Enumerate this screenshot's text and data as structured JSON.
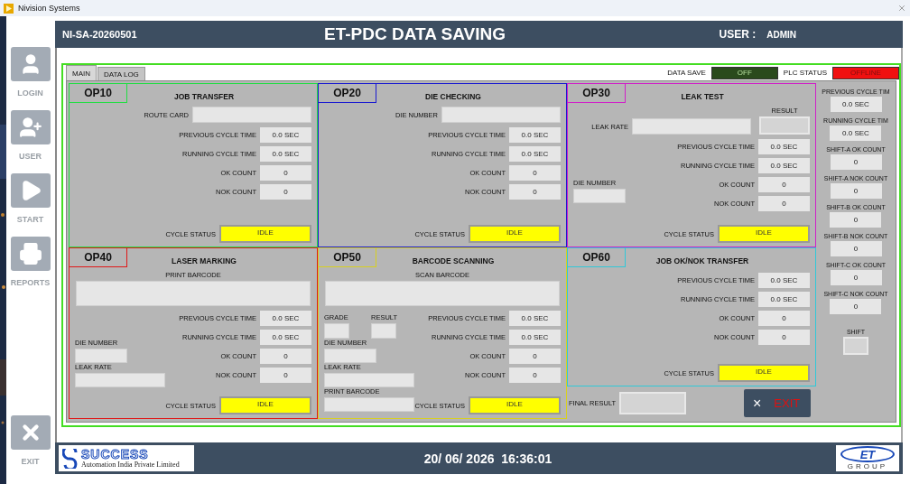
{
  "window": {
    "title": "Nivision Systems"
  },
  "sidebar": {
    "items": [
      {
        "kind": "login",
        "label": "LOGIN"
      },
      {
        "kind": "user",
        "label": "USER"
      },
      {
        "kind": "start",
        "label": "START"
      },
      {
        "kind": "reports",
        "label": "REPORTS"
      },
      {
        "kind": "exit",
        "label": "EXIT"
      }
    ]
  },
  "header": {
    "machine_id": "NI-SA-20260501",
    "title": "ET-PDC DATA SAVING",
    "user_label": "USER :",
    "user": "ADMIN"
  },
  "tabs": [
    {
      "label": "MAIN",
      "selected": true
    },
    {
      "label": "DATA LOG",
      "selected": false
    }
  ],
  "indicators": [
    {
      "kind": "switch",
      "label": "DATA SAVE",
      "value": "OFF",
      "on": false
    },
    {
      "kind": "status",
      "label": "PLC STATUS",
      "value": "OFFLINE",
      "on": false
    }
  ],
  "stations": [
    {
      "tag": "OP10",
      "title": "JOB TRANSFER",
      "color": "#22dd44",
      "top": [
        {
          "kind": "inline",
          "label": "ROUTE CARD"
        }
      ],
      "metrics": [
        {
          "label": "PREVIOUS CYCLE TIME",
          "value": "0.0 SEC"
        },
        {
          "label": "RUNNING CYCLE TIME",
          "value": "0.0 SEC"
        },
        {
          "label": "OK COUNT",
          "value": "0"
        },
        {
          "label": "NOK COUNT",
          "value": "0"
        }
      ],
      "status": {
        "label": "CYCLE STATUS",
        "value": "IDLE"
      }
    },
    {
      "tag": "OP20",
      "title": "DIE CHECKING",
      "color": "#1a1ad0",
      "top": [
        {
          "kind": "inline",
          "label": "DIE NUMBER"
        }
      ],
      "metrics": [
        {
          "label": "PREVIOUS CYCLE TIME",
          "value": "0.0 SEC"
        },
        {
          "label": "RUNNING CYCLE TIME",
          "value": "0.0 SEC"
        },
        {
          "label": "OK COUNT",
          "value": "0"
        },
        {
          "label": "NOK COUNT",
          "value": "0"
        }
      ],
      "status": {
        "label": "CYCLE STATUS",
        "value": "IDLE"
      }
    },
    {
      "tag": "OP30",
      "title": "LEAK TEST",
      "color": "#d020c8",
      "top": [
        {
          "kind": "inline",
          "label": "LEAK RATE"
        },
        {
          "kind": "result",
          "label": "RESULT"
        }
      ],
      "side": [
        {
          "kind": "stacked",
          "label": "DIE NUMBER"
        }
      ],
      "metrics": [
        {
          "label": "PREVIOUS CYCLE TIME",
          "value": "0.0 SEC"
        },
        {
          "label": "RUNNING CYCLE TIME",
          "value": "0.0 SEC"
        },
        {
          "label": "OK COUNT",
          "value": "0"
        },
        {
          "label": "NOK COUNT",
          "value": "0"
        }
      ],
      "status": {
        "label": "CYCLE STATUS",
        "value": "IDLE"
      }
    },
    {
      "tag": "OP40",
      "title": "LASER MARKING",
      "color": "#e01818",
      "top": [
        {
          "kind": "barcode",
          "label": "PRINT BARCODE"
        }
      ],
      "side": [
        {
          "kind": "stacked",
          "label": "DIE NUMBER"
        },
        {
          "kind": "long",
          "label": "LEAK RATE"
        }
      ],
      "metrics": [
        {
          "label": "PREVIOUS CYCLE TIME",
          "value": "0.0 SEC"
        },
        {
          "label": "RUNNING CYCLE TIME",
          "value": "0.0 SEC"
        },
        {
          "label": "OK COUNT",
          "value": "0"
        },
        {
          "label": "NOK COUNT",
          "value": "0"
        }
      ],
      "status": {
        "label": "CYCLE STATUS",
        "value": "IDLE"
      }
    },
    {
      "tag": "OP50",
      "title": "BARCODE SCANNING",
      "color": "#d8d020",
      "top": [
        {
          "kind": "barcode",
          "label": "SCAN BARCODE"
        }
      ],
      "side": [
        {
          "kind": "small",
          "label": "GRADE"
        },
        {
          "kind": "small",
          "label": "RESULT"
        },
        {
          "kind": "stacked",
          "label": "DIE NUMBER"
        },
        {
          "kind": "long",
          "label": "LEAK RATE"
        },
        {
          "kind": "long",
          "label": "PRINT BARCODE"
        }
      ],
      "metrics": [
        {
          "label": "PREVIOUS CYCLE TIME",
          "value": "0.0 SEC"
        },
        {
          "label": "RUNNING CYCLE TIME",
          "value": "0.0 SEC"
        },
        {
          "label": "OK COUNT",
          "value": "0"
        },
        {
          "label": "NOK COUNT",
          "value": "0"
        }
      ],
      "status": {
        "label": "CYCLE STATUS",
        "value": "IDLE"
      }
    },
    {
      "tag": "OP60",
      "title": "JOB OK/NOK TRANSFER",
      "color": "#30c8d8",
      "metrics": [
        {
          "label": "PREVIOUS CYCLE TIME",
          "value": "0.0 SEC"
        },
        {
          "label": "RUNNING CYCLE TIME",
          "value": "0.0 SEC"
        },
        {
          "label": "OK COUNT",
          "value": "0"
        },
        {
          "label": "NOK COUNT",
          "value": "0"
        }
      ],
      "status": {
        "label": "CYCLE STATUS",
        "value": "IDLE"
      }
    }
  ],
  "shift_panel": [
    {
      "kind": "metric",
      "label": "PREVIOUS CYCLE TIM",
      "value": "0.0 SEC"
    },
    {
      "kind": "metric",
      "label": "RUNNING CYCLE TIM",
      "value": "0.0 SEC"
    },
    {
      "kind": "metric",
      "label": "SHIFT-A OK COUNT",
      "value": "0"
    },
    {
      "kind": "metric",
      "label": "SHIFT-A NOK COUNT",
      "value": "0"
    },
    {
      "kind": "metric",
      "label": "SHIFT-B OK COUNT",
      "value": "0"
    },
    {
      "kind": "metric",
      "label": "SHIFT-B NOK COUNT",
      "value": "0"
    },
    {
      "kind": "metric",
      "label": "SHIFT-C OK COUNT",
      "value": "0"
    },
    {
      "kind": "metric",
      "label": "SHIFT-C NOK COUNT",
      "value": "0"
    },
    {
      "kind": "small",
      "label": "SHIFT"
    }
  ],
  "final_result": {
    "label": "FINAL RESULT"
  },
  "exit_button": {
    "icon": "×",
    "label": "EXIT"
  },
  "footer": {
    "company": "SUCCESS",
    "company_tagline": "Automation India Private Limited",
    "datetime": "20/ 06/ 2026  16:36:01",
    "brand": "ET",
    "brand_sub": "GROUP"
  }
}
